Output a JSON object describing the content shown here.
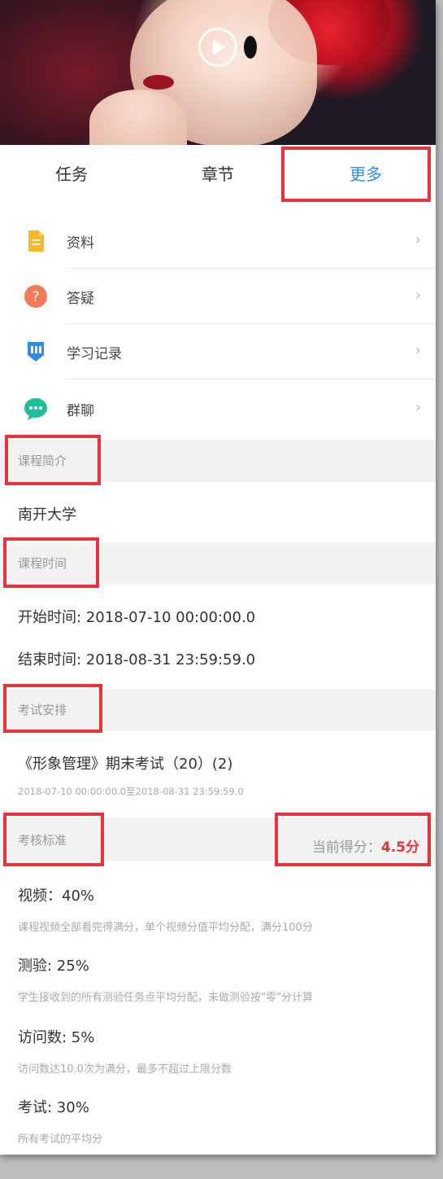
{
  "tabs": [
    {
      "label": "任务"
    },
    {
      "label": "章节"
    },
    {
      "label": "更多",
      "active": true
    }
  ],
  "menu": [
    {
      "label": "资料",
      "icon": "document-icon",
      "color": "#f7b928"
    },
    {
      "label": "答疑",
      "icon": "question-icon",
      "color": "#f4795a"
    },
    {
      "label": "学习记录",
      "icon": "bookmark-icon",
      "color": "#2e8be6"
    },
    {
      "label": "群聊",
      "icon": "chat-icon",
      "color": "#1fbf9a"
    }
  ],
  "intro": {
    "heading": "课程简介",
    "content": "南开大学"
  },
  "time": {
    "heading": "课程时间",
    "start": "开始时间: 2018-07-10 00:00:00.0",
    "end": "结束时间: 2018-08-31 23:59:59.0"
  },
  "exam": {
    "heading": "考试安排",
    "title": "《形象管理》期末考试（20）(2)",
    "range": "2018-07-10 00:00:00.0至2018-08-31 23:59:59.0"
  },
  "criteria": {
    "heading": "考核标准",
    "score_label": "当前得分：",
    "score_value": "4.5分",
    "items": [
      {
        "title": "视频：40%",
        "desc": "课程视频全部看完得满分，单个视频分值平均分配，满分100分"
      },
      {
        "title": "测验: 25%",
        "desc": "学生接收到的所有测验任务点平均分配，未做测验按\"零\"分计算"
      },
      {
        "title": "访问数: 5%",
        "desc": "访问数达10.0次为满分，最多不超过上限分数"
      },
      {
        "title": "考试: 30%",
        "desc": "所有考试的平均分"
      }
    ]
  },
  "colors": {
    "accent": "#2a8cf0",
    "highlight": "#e8323c",
    "score": "#e8323c"
  }
}
